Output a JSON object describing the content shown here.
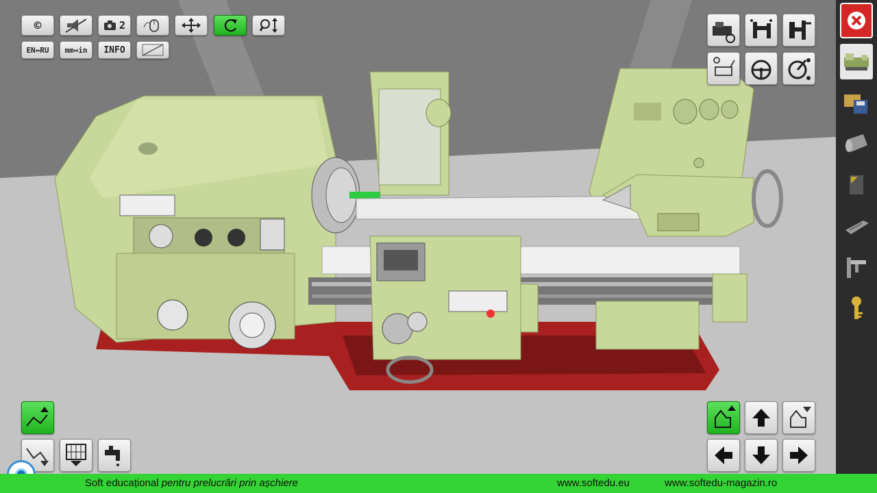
{
  "top_toolbar": {
    "row1": [
      {
        "label": "©",
        "icon": "copyright-icon",
        "active": false
      },
      {
        "label": "",
        "icon": "mute-icon",
        "active": false
      },
      {
        "label": "2",
        "icon": "camera-icon",
        "active": false
      },
      {
        "label": "",
        "icon": "mouse-icon",
        "active": false
      },
      {
        "label": "",
        "icon": "move-arrows-icon",
        "active": false
      },
      {
        "label": "",
        "icon": "rotate-icon",
        "active": true
      },
      {
        "label": "",
        "icon": "zoom-icon",
        "active": false
      }
    ],
    "row2": [
      {
        "label": "EN↔RU",
        "icon": "language-icon"
      },
      {
        "label": "mm↔in",
        "icon": "units-icon"
      },
      {
        "label": "INFO",
        "icon": "info-icon"
      },
      {
        "label": "",
        "icon": "screen-icon"
      }
    ]
  },
  "footer": {
    "left_prefix": "Soft educațional ",
    "left_italic": "pentru prelucrări prin așchiere",
    "link1": "www.softedu.eu",
    "link2": "www.softedu-magazin.ro"
  },
  "colors": {
    "machine": "#c8d79a",
    "machine_dark": "#9fb06e",
    "bed_red": "#a8201f",
    "footer_green": "#34d434",
    "active_green": "#22b522"
  }
}
